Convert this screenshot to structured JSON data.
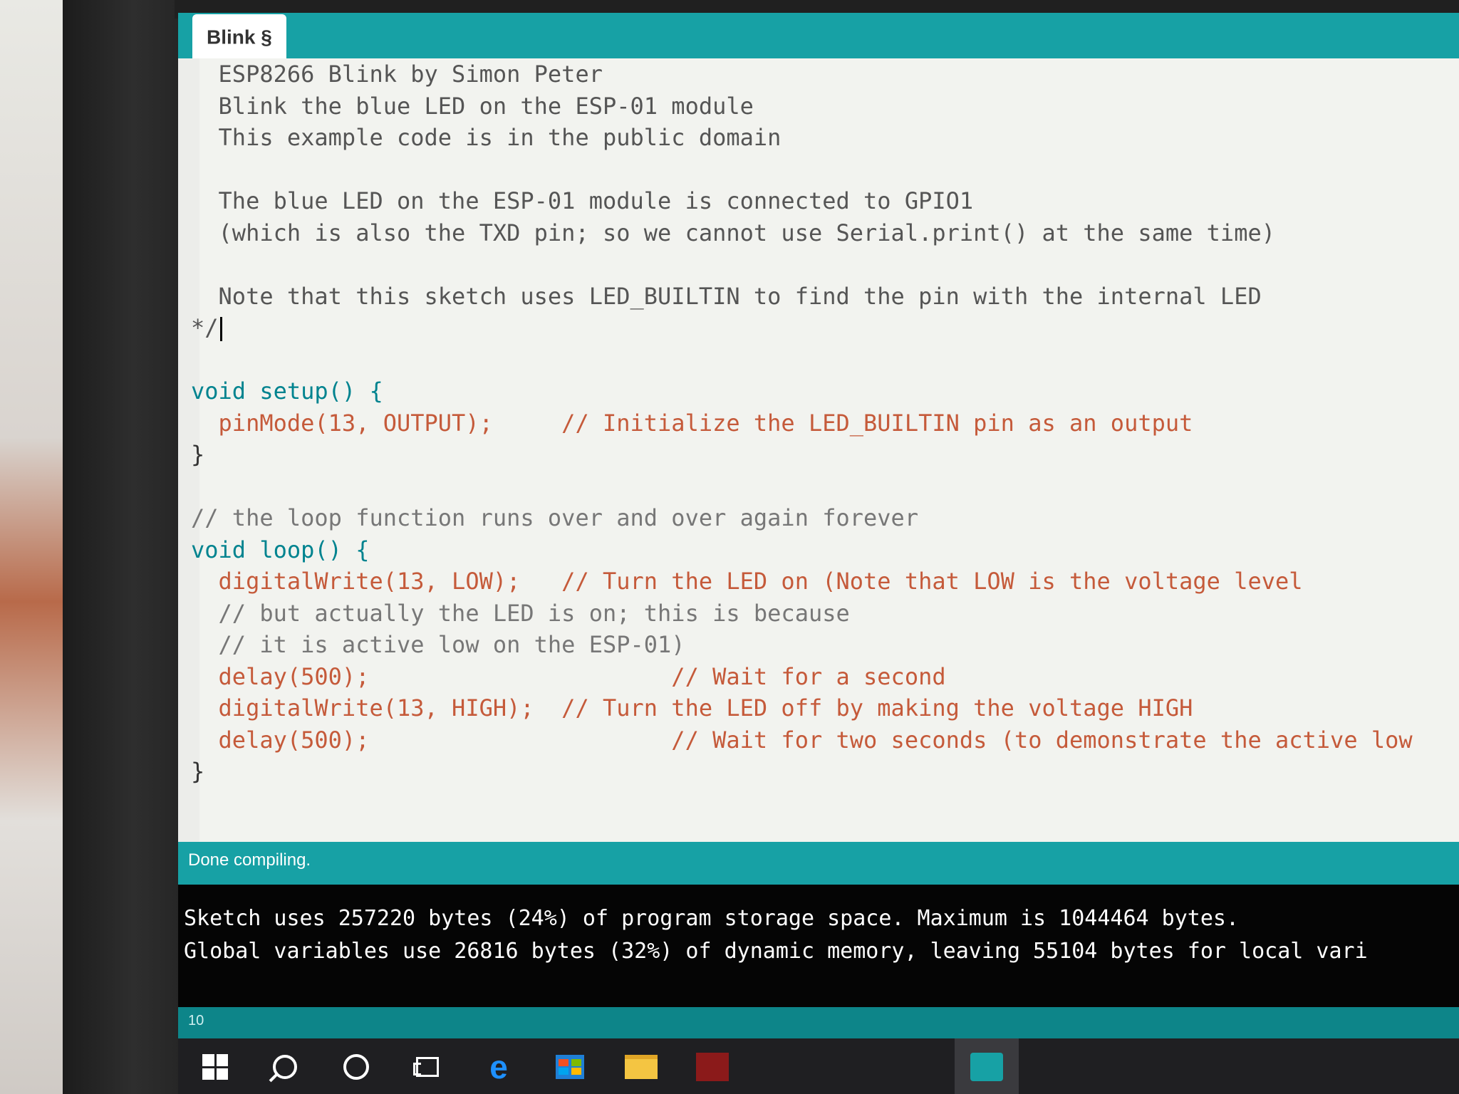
{
  "window": {
    "tab_label": "Blink §"
  },
  "editor": {
    "lines": [
      {
        "cls": "c-gray",
        "text": "  ESP8266 Blink by Simon Peter"
      },
      {
        "cls": "c-gray",
        "text": "  Blink the blue LED on the ESP-01 module"
      },
      {
        "cls": "c-gray",
        "text": "  This example code is in the public domain"
      },
      {
        "cls": "c-gray",
        "text": ""
      },
      {
        "cls": "c-gray",
        "text": "  The blue LED on the ESP-01 module is connected to GPIO1"
      },
      {
        "cls": "c-gray",
        "text": "  (which is also the TXD pin; so we cannot use Serial.print() at the same time)"
      },
      {
        "cls": "c-gray",
        "text": ""
      },
      {
        "cls": "c-gray",
        "text": "  Note that this sketch uses LED_BUILTIN to find the pin with the internal LED"
      },
      {
        "cls": "c-gray",
        "text": "*/"
      },
      {
        "cls": "c-gray",
        "text": ""
      },
      {
        "cls": "c-kw",
        "text": "void setup() {"
      },
      {
        "cls": "c-fn",
        "text": "  pinMode(13, OUTPUT);     // Initialize the LED_BUILTIN pin as an output"
      },
      {
        "cls": "c-plain",
        "text": "}"
      },
      {
        "cls": "c-plain",
        "text": ""
      },
      {
        "cls": "c-com",
        "text": "// the loop function runs over and over again forever"
      },
      {
        "cls": "c-kw",
        "text": "void loop() {"
      },
      {
        "cls": "c-fn",
        "text": "  digitalWrite(13, LOW);   // Turn the LED on (Note that LOW is the voltage level"
      },
      {
        "cls": "c-com",
        "text": "  // but actually the LED is on; this is because"
      },
      {
        "cls": "c-com",
        "text": "  // it is active low on the ESP-01)"
      },
      {
        "cls": "c-fn",
        "text": "  delay(500);                      // Wait for a second"
      },
      {
        "cls": "c-fn",
        "text": "  digitalWrite(13, HIGH);  // Turn the LED off by making the voltage HIGH"
      },
      {
        "cls": "c-fn",
        "text": "  delay(500);                      // Wait for two seconds (to demonstrate the active low"
      },
      {
        "cls": "c-plain",
        "text": "}"
      }
    ]
  },
  "status": {
    "message": "Done compiling."
  },
  "console": {
    "lines": [
      "Sketch uses 257220 bytes (24%) of program storage space. Maximum is 1044464 bytes.",
      "Global variables use 26816 bytes (32%) of dynamic memory, leaving 55104 bytes for local vari"
    ]
  },
  "footer": {
    "line_number": "10"
  },
  "taskbar": {
    "icons": [
      "windows-start-icon",
      "search-icon",
      "cortana-icon",
      "task-view-icon",
      "edge-browser-icon",
      "store-icon",
      "file-explorer-icon",
      "app-icon",
      "arduino-icon"
    ]
  }
}
